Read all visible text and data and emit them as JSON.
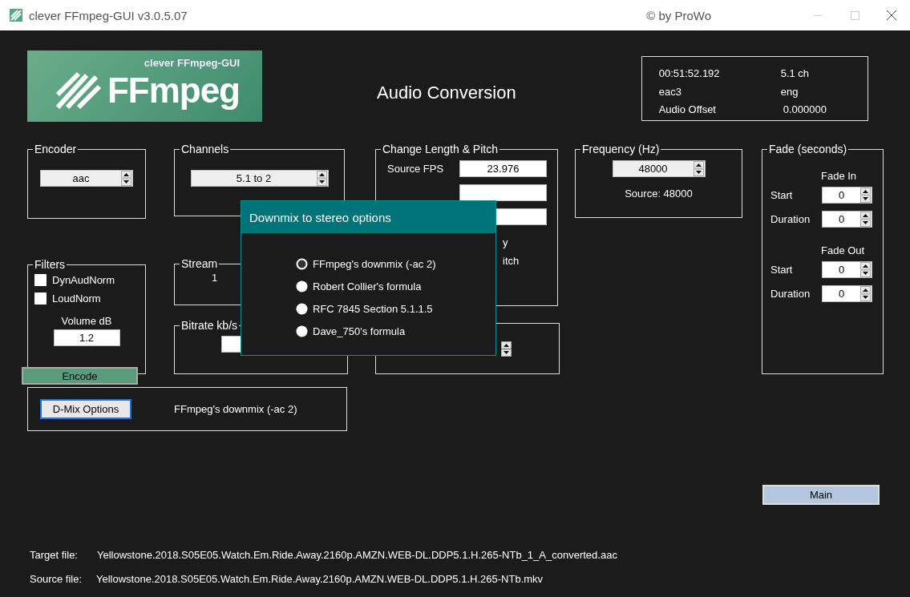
{
  "window": {
    "title": "clever FFmpeg-GUI v3.0.5.07",
    "credit": "© by ProWo"
  },
  "logo": {
    "caption": "clever FFmpeg-GUI",
    "wordmark": "FFmpeg"
  },
  "heading": "Audio Conversion",
  "info": [
    {
      "label": "00:51:52.192",
      "value": "5.1 ch"
    },
    {
      "label": "eac3",
      "value": "eng"
    },
    {
      "label": "Audio Offset",
      "value": "0.000000"
    }
  ],
  "encoder": {
    "title": "Encoder",
    "value": "aac"
  },
  "channels": {
    "title": "Channels",
    "value": "5.1 to 2"
  },
  "change_length": {
    "title": "Change Length & Pitch",
    "source_fps_label": "Source FPS",
    "source_fps": "23.976",
    "fragment_1": "y",
    "fragment_2": "itch"
  },
  "frequency": {
    "title": "Frequency (Hz)",
    "value": "48000",
    "source": "Source: 48000"
  },
  "fade": {
    "title": "Fade (seconds)",
    "sections": [
      {
        "heading": "Fade In",
        "rows": [
          {
            "label": "Start",
            "value": "0"
          },
          {
            "label": "Duration",
            "value": "0"
          }
        ]
      },
      {
        "heading": "Fade Out",
        "rows": [
          {
            "label": "Start",
            "value": "0"
          },
          {
            "label": "Duration",
            "value": "0"
          }
        ]
      }
    ]
  },
  "filters": {
    "title": "Filters",
    "checks": [
      {
        "label": "DynAudNorm",
        "checked": false
      },
      {
        "label": "LoudNorm",
        "checked": false
      }
    ],
    "volume_label": "Volume dB",
    "volume": "1.2"
  },
  "stream": {
    "title": "Stream",
    "value": "1"
  },
  "bitrate": {
    "title": "Bitrate kb/s"
  },
  "encode_button": "Encode",
  "dmix": {
    "button": "D-Mix Options",
    "value": "FFmpeg's downmix (-ac 2)"
  },
  "main_button": "Main",
  "files": [
    {
      "label": "Target file:",
      "value": "Yellowstone.2018.S05E05.Watch.Em.Ride.Away.2160p.AMZN.WEB-DL.DDP5.1.H.265-NTb_1_A_converted.aac"
    },
    {
      "label": "Source file:",
      "value": "Yellowstone.2018.S05E05.Watch.Em.Ride.Away.2160p.AMZN.WEB-DL.DDP5.1.H.265-NTb.mkv"
    }
  ],
  "dialog": {
    "title": "Downmix to stereo options",
    "options": [
      {
        "label": "FFmpeg's downmix (-ac 2)",
        "selected": true
      },
      {
        "label": "Robert Collier's formula",
        "selected": false
      },
      {
        "label": "RFC 7845 Section 5.1.1.5",
        "selected": false
      },
      {
        "label": "Dave_750's formula",
        "selected": false
      }
    ]
  }
}
